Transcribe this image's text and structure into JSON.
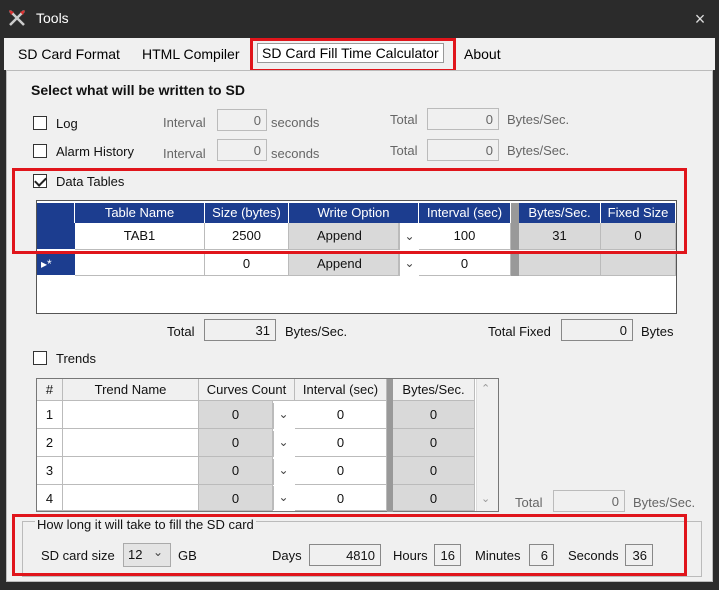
{
  "window": {
    "title": "Tools",
    "close_glyph": "×"
  },
  "tabs": [
    {
      "label": "SD Card Format"
    },
    {
      "label": "HTML Compiler"
    },
    {
      "label": "SD Card Fill Time Calculator",
      "active": true
    },
    {
      "label": "About"
    }
  ],
  "section_heading": "Select what will be written to SD",
  "log": {
    "label": "Log",
    "interval_label": "Interval",
    "interval_value": "0",
    "seconds_label": "seconds",
    "total_label": "Total",
    "total_value": "0",
    "unit": "Bytes/Sec."
  },
  "alarm": {
    "label": "Alarm History",
    "interval_label": "Interval",
    "interval_value": "0",
    "seconds_label": "seconds",
    "total_label": "Total",
    "total_value": "0",
    "unit": "Bytes/Sec."
  },
  "data_tables": {
    "label": "Data Tables",
    "columns": [
      "Table Name",
      "Size (bytes)",
      "Write Option",
      "Interval (sec)",
      "Bytes/Sec.",
      "Fixed Size"
    ],
    "rows": [
      {
        "name": "TAB1",
        "size": "2500",
        "write": "Append",
        "interval": "100",
        "bps": "31",
        "fixed": "0"
      }
    ],
    "new_row": {
      "marker": "▸*",
      "size": "0",
      "write": "Append",
      "interval": "0"
    },
    "total_label": "Total",
    "total_value": "31",
    "total_unit": "Bytes/Sec.",
    "fixed_label": "Total Fixed",
    "fixed_value": "0",
    "fixed_unit": "Bytes"
  },
  "trends": {
    "label": "Trends",
    "columns": [
      "#",
      "Trend Name",
      "Curves Count",
      "Interval (sec)",
      "Bytes/Sec."
    ],
    "rows": [
      {
        "num": "1",
        "name": "",
        "curves": "0",
        "interval": "0",
        "bps": "0"
      },
      {
        "num": "2",
        "name": "",
        "curves": "0",
        "interval": "0",
        "bps": "0"
      },
      {
        "num": "3",
        "name": "",
        "curves": "0",
        "interval": "0",
        "bps": "0"
      },
      {
        "num": "4",
        "name": "",
        "curves": "0",
        "interval": "0",
        "bps": "0"
      }
    ],
    "total_label": "Total",
    "total_value": "0",
    "total_unit": "Bytes/Sec."
  },
  "fill": {
    "caption": "How long it will take to fill the SD card",
    "size_label": "SD card size",
    "size_value": "12",
    "size_unit": "GB",
    "days_label": "Days",
    "days_value": "4810",
    "hours_label": "Hours",
    "hours_value": "16",
    "minutes_label": "Minutes",
    "minutes_value": "6",
    "seconds_label": "Seconds",
    "seconds_value": "36"
  },
  "colors": {
    "highlight": "#e0151b",
    "grid_header": "#1c3d8f"
  }
}
